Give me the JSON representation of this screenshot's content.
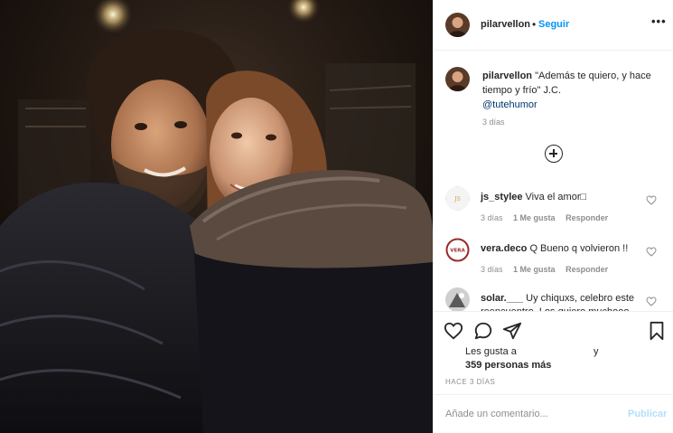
{
  "post": {
    "username": "pilarvellon",
    "separator": "•",
    "follow_label": "Seguir",
    "more_label": "•••"
  },
  "caption": {
    "username": "pilarvellon",
    "text": "\"Además te quiero, y hace tiempo y frío\" J.C.",
    "mention": "@tutehumor",
    "time": "3 días"
  },
  "comments": [
    {
      "username": "js_stylee",
      "text": "Viva el amor□",
      "time": "3 días",
      "likes": "1 Me gusta",
      "reply": "Responder"
    },
    {
      "username": "vera.deco",
      "text": "Q Bueno q volvieron !!",
      "time": "3 días",
      "likes": "1 Me gusta",
      "reply": "Responder"
    },
    {
      "username": "solar.___",
      "text": "Uy chiquxs, celebro este reencuentro. Los quiero muchooo",
      "time": "",
      "likes": "",
      "reply": ""
    }
  ],
  "likes": {
    "prefix": "Les gusta a",
    "conjunction": "y",
    "count_text": "359 personas más"
  },
  "posted_ago": "HACE 3 DÍAS",
  "add_comment": {
    "placeholder": "Añade un comentario...",
    "publish_label": "Publicar"
  },
  "icons": {
    "load_more": "plus-circle-icon",
    "like": "heart-icon",
    "comment": "comment-bubble-icon",
    "share": "paper-plane-icon",
    "save": "bookmark-icon",
    "more": "ellipsis-icon"
  },
  "colors": {
    "link_blue": "#0095f6",
    "mention_blue": "#00376b",
    "secondary_text": "#8e8e8e",
    "publish_disabled": "#b2dffc",
    "border": "#efefef"
  }
}
